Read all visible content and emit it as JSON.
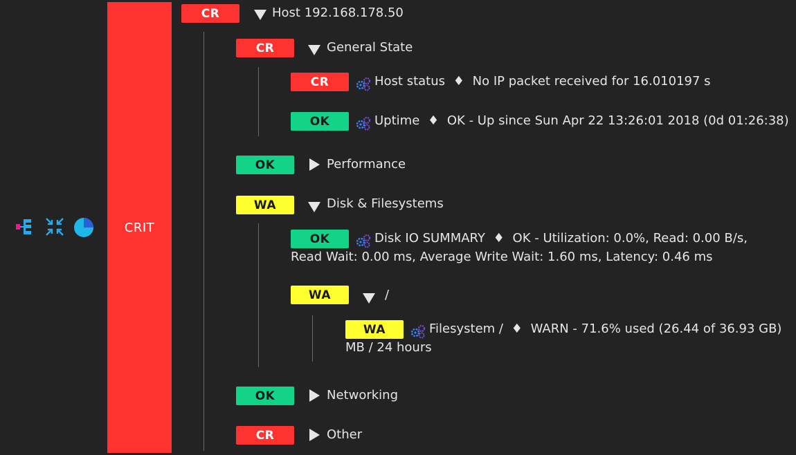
{
  "colors": {
    "crit": "#ff3232",
    "ok": "#13d389",
    "warn": "#ffff30",
    "background": "#232323",
    "text": "#e6e6e6"
  },
  "sidebar": {
    "icons": [
      "hierarchy-icon",
      "collapse-arrows-icon",
      "pie-chart-icon"
    ],
    "state_label": "CRIT"
  },
  "root": {
    "state": "CR",
    "title": "Host 192.168.178.50"
  },
  "general_state": {
    "state": "CR",
    "title": "General State",
    "host_status": {
      "state": "CR",
      "name": "Host status",
      "sep": "♦",
      "output": "No IP packet received for 16.010197 s"
    },
    "uptime": {
      "state": "OK",
      "name": "Uptime",
      "sep": "♦",
      "output": "OK - Up since Sun Apr 22 13:26:01 2018 (0d 01:26:38)"
    }
  },
  "performance": {
    "state": "OK",
    "title": "Performance"
  },
  "disk": {
    "state": "WA",
    "title": "Disk & Filesystems",
    "disk_io": {
      "state": "OK",
      "name": "Disk IO SUMMARY",
      "sep": "♦",
      "output_line1": "OK - Utilization: 0.0%, Read: 0.00 B/s,",
      "output_line2": "Read Wait: 0.00 ms, Average Write Wait: 1.60 ms, Latency: 0.46 ms"
    },
    "root_fs_group": {
      "state": "WA",
      "title": "/"
    },
    "filesystem": {
      "state": "WA",
      "name": "Filesystem /",
      "sep": "♦",
      "output_line1": "WARN - 71.6% used (26.44 of 36.93 GB)",
      "output_line2": "MB / 24 hours"
    }
  },
  "networking": {
    "state": "OK",
    "title": "Networking"
  },
  "other": {
    "state": "CR",
    "title": "Other"
  }
}
